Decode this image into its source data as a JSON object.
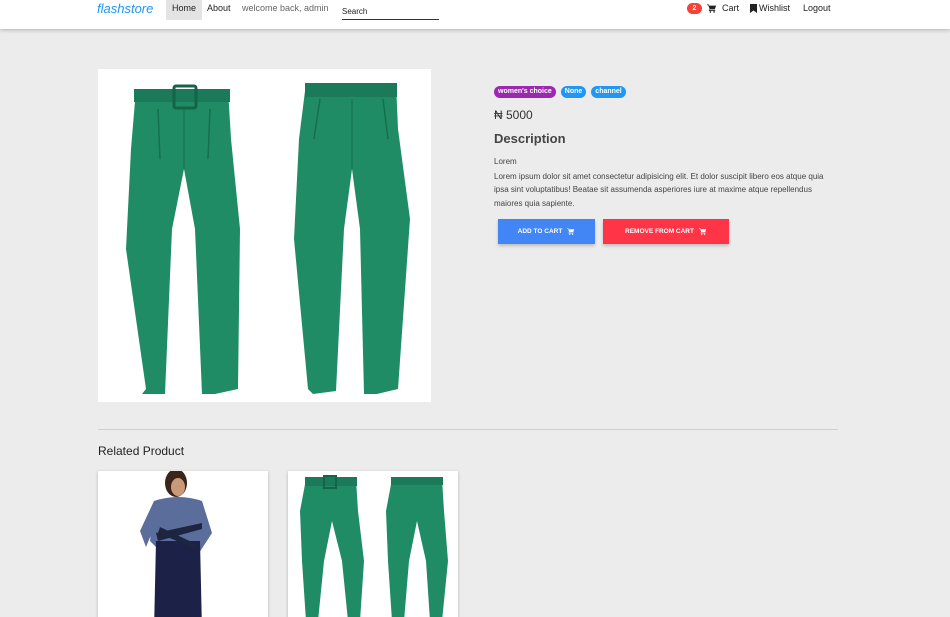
{
  "navbar": {
    "brand": "flashstore",
    "home": "Home",
    "about": "About",
    "welcome": "welcome back, admin",
    "search_placeholder": "Search",
    "cart_count": "2",
    "cart": "Cart",
    "wishlist": "Wishlist",
    "logout": "Logout"
  },
  "product": {
    "tags": [
      "women's choice",
      "None",
      "channel"
    ],
    "price": "₦ 5000",
    "description_heading": "Description",
    "description_title": "Lorem",
    "description_text": "Lorem ipsum dolor sit amet consectetur adipisicing elit. Et dolor suscipit libero eos atque quia ipsa sint voluptatibus! Beatae sit assumenda asperiores iure at maxime atque repellendus maiores quia sapiente.",
    "add_to_cart": "ADD TO CART",
    "remove_from_cart": "REMOVE FROM CART"
  },
  "related": {
    "title": "Related Product"
  },
  "colors": {
    "brand": "#2196f3",
    "add_button": "#4285f4",
    "remove_button": "#ff3547",
    "tag_purple": "#9c27b0",
    "tag_blue": "#2196f3",
    "badge": "#f44336",
    "pants_green": "#1f8c66"
  },
  "icons": [
    "cart-icon",
    "bookmark-icon"
  ]
}
